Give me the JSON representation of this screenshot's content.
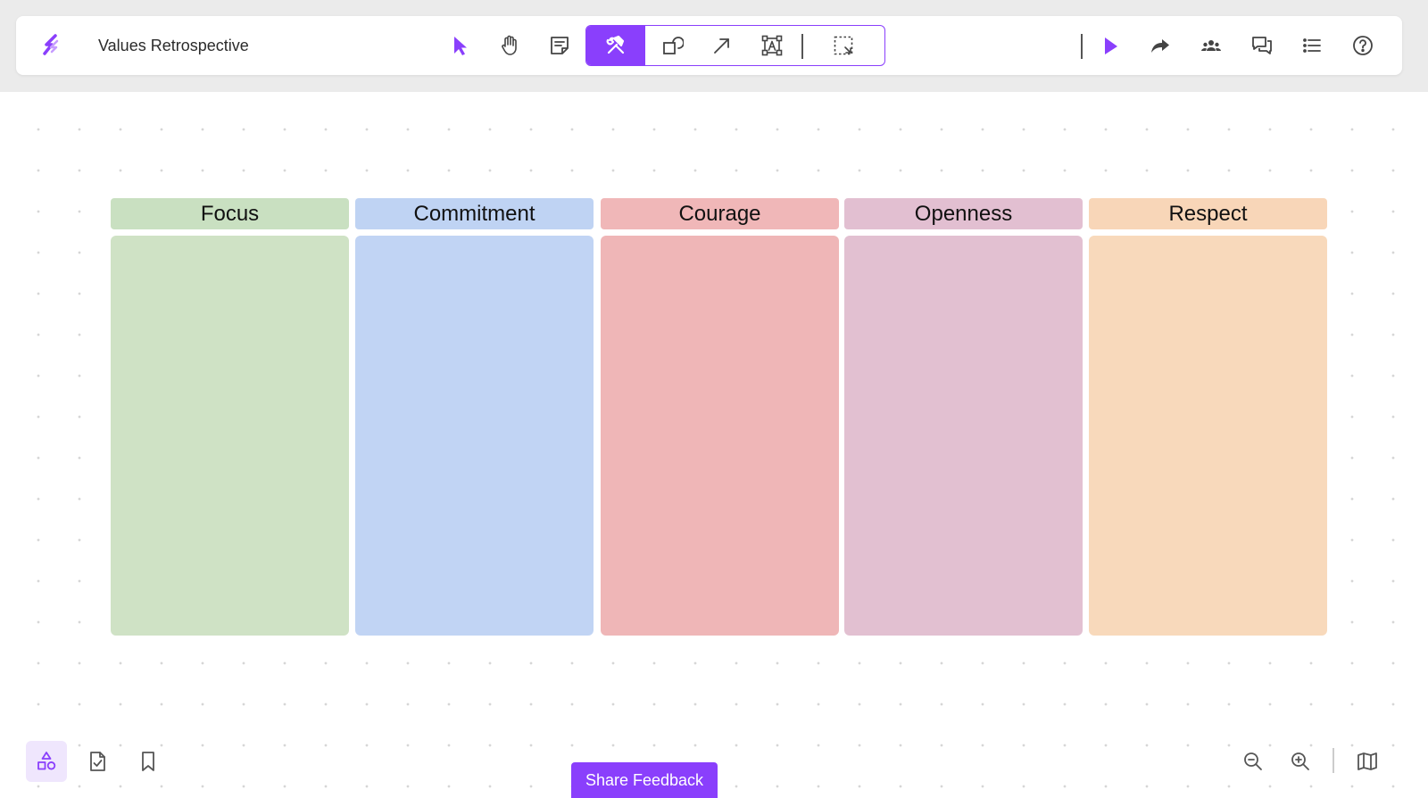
{
  "app": {
    "board_title": "Values Retrospective",
    "accent_color": "#8a3ffc"
  },
  "toolbar": {
    "tools": [
      {
        "name": "select",
        "icon": "cursor-arrow-icon"
      },
      {
        "name": "pan",
        "icon": "hand-icon"
      },
      {
        "name": "sticky-note",
        "icon": "sticky-note-icon"
      },
      {
        "name": "tools",
        "icon": "hammer-wrench-icon",
        "active": true
      },
      {
        "name": "shapes",
        "icon": "shapes-icon"
      },
      {
        "name": "connector",
        "icon": "arrow-icon"
      },
      {
        "name": "text",
        "icon": "text-box-icon"
      },
      {
        "name": "frame-select",
        "icon": "dashed-select-icon"
      }
    ],
    "right_tools": [
      {
        "name": "present",
        "icon": "play-icon"
      },
      {
        "name": "share",
        "icon": "share-arrow-icon"
      },
      {
        "name": "collaborators",
        "icon": "people-icon"
      },
      {
        "name": "comments",
        "icon": "comments-icon"
      },
      {
        "name": "outline",
        "icon": "list-icon"
      },
      {
        "name": "help",
        "icon": "help-circle-icon"
      }
    ]
  },
  "columns": [
    {
      "title": "Focus",
      "header_color": "#c9e0c1",
      "body_color": "#cfe2c5"
    },
    {
      "title": "Commitment",
      "header_color": "#bfd3f3",
      "body_color": "#c1d4f4"
    },
    {
      "title": "Courage",
      "header_color": "#f0b7b8",
      "body_color": "#efb6b7"
    },
    {
      "title": "Openness",
      "header_color": "#e2bfd1",
      "body_color": "#e2c0d1"
    },
    {
      "title": "Respect",
      "header_color": "#f8d6b8",
      "body_color": "#f8d9bb"
    }
  ],
  "bottom_bar": {
    "left_tools": [
      {
        "name": "templates",
        "icon": "shapes-library-icon",
        "active": true
      },
      {
        "name": "tasks",
        "icon": "document-check-icon"
      },
      {
        "name": "bookmarks",
        "icon": "bookmark-icon"
      }
    ],
    "share_feedback_label": "Share Feedback",
    "right_tools": [
      {
        "name": "zoom-out",
        "icon": "zoom-out-icon"
      },
      {
        "name": "zoom-in",
        "icon": "zoom-in-icon"
      },
      {
        "name": "minimap",
        "icon": "map-icon"
      }
    ]
  }
}
